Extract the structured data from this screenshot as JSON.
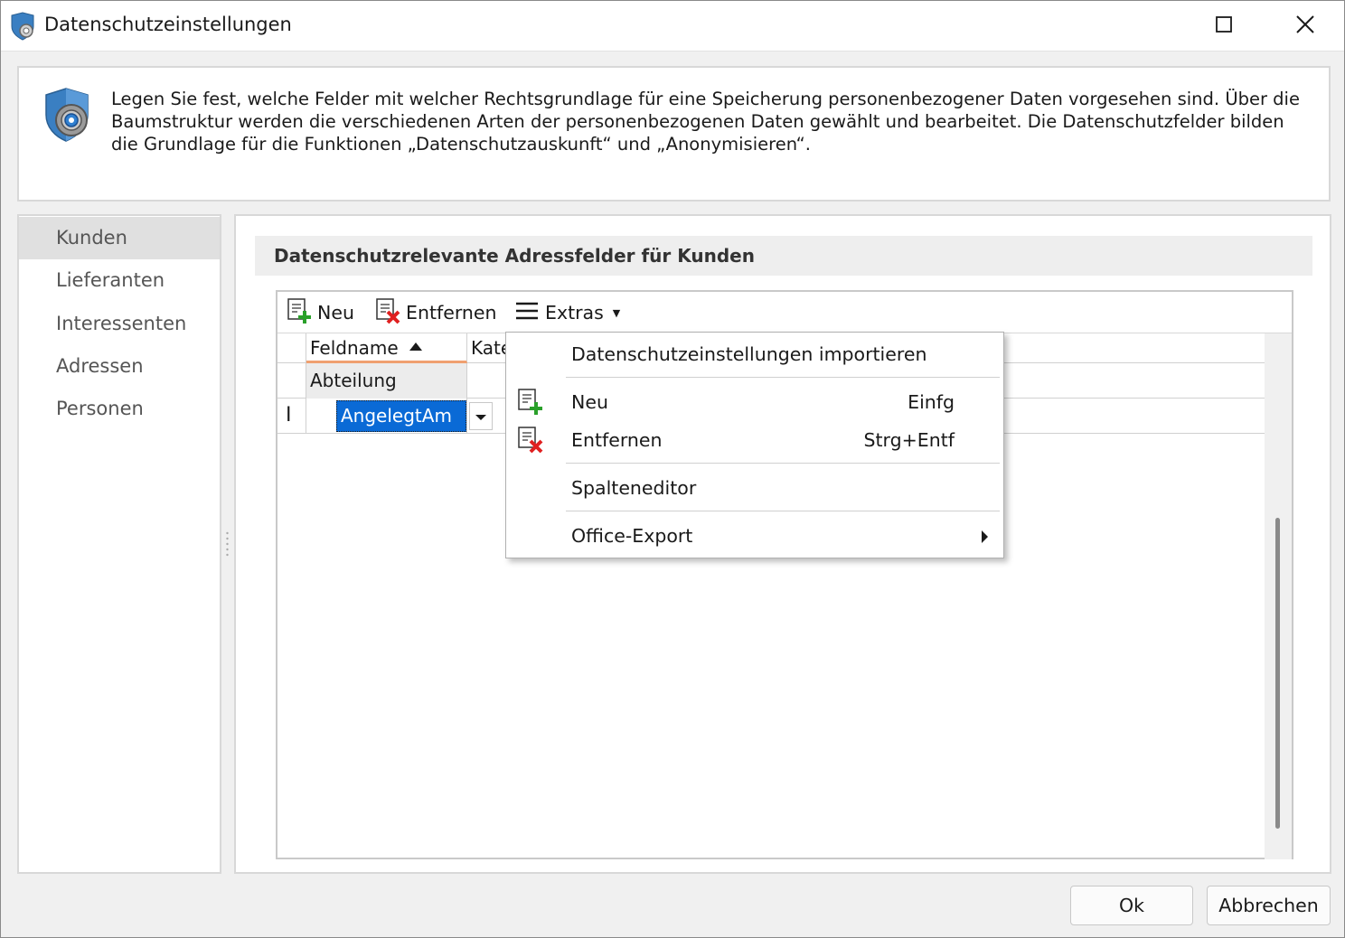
{
  "window": {
    "title": "Datenschutzeinstellungen",
    "icon": "shield-gear-icon"
  },
  "info": {
    "text": "Legen Sie fest, welche Felder mit welcher Rechtsgrundlage für eine Speicherung personenbezogener Daten vorgesehen sind. Über die Baumstruktur werden die verschiedenen Arten der personenbezogenen Daten gewählt und bearbeitet. Die Datenschutzfelder bilden die Grundlage für die Funktionen „Datenschutzauskunft“ und „Anonymisieren“."
  },
  "sidebar": {
    "items": [
      {
        "label": "Kunden",
        "active": true
      },
      {
        "label": "Lieferanten",
        "active": false
      },
      {
        "label": "Interessenten",
        "active": false
      },
      {
        "label": "Adressen",
        "active": false
      },
      {
        "label": "Personen",
        "active": false
      }
    ]
  },
  "main": {
    "group_title": "Datenschutzrelevante Adressfelder für Kunden",
    "toolbar": {
      "neu_label": "Neu",
      "entfernen_label": "Entfernen",
      "extras_label": "Extras"
    },
    "grid": {
      "columns": [
        "Feldname",
        "Kate"
      ],
      "rows": [
        {
          "feldname": "Abteilung"
        },
        {
          "feldname": "AngelegtAm"
        }
      ]
    }
  },
  "context_menu": {
    "items": [
      {
        "label": "Datenschutzeinstellungen importieren",
        "shortcut": ""
      },
      {
        "label": "Neu",
        "shortcut": "Einfg"
      },
      {
        "label": "Entfernen",
        "shortcut": "Strg+Entf"
      },
      {
        "label": "Spalteneditor",
        "shortcut": ""
      },
      {
        "label": "Office-Export",
        "shortcut": ""
      }
    ]
  },
  "buttons": {
    "ok_label": "Ok",
    "cancel_label": "Abbrechen"
  },
  "colors": {
    "selection": "#0a6ad6",
    "sort_underline": "#f0a070",
    "add_green": "#2aa02a",
    "remove_red": "#e02020",
    "shield_blue": "#3a7fc2"
  }
}
